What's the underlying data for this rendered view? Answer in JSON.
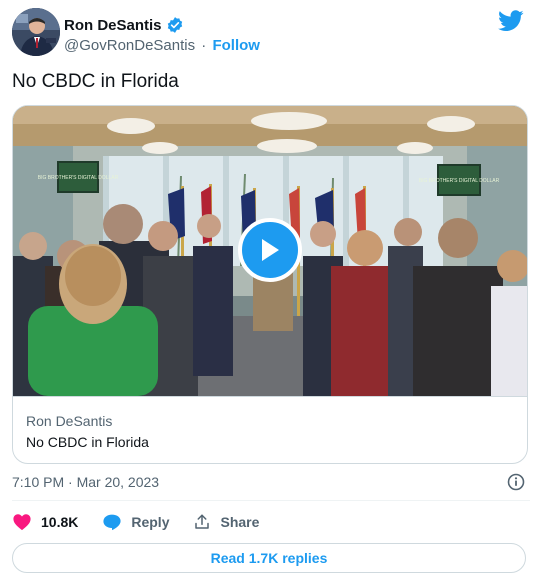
{
  "author": {
    "name": "Ron DeSantis",
    "handle": "@GovRonDeSantis",
    "separator": "·",
    "follow_label": "Follow",
    "verified_icon": "verified-badge-icon",
    "avatar_icon": "profile-photo"
  },
  "brand_icon": "twitter-bird-icon",
  "tweet": {
    "text": "No CBDC in Florida",
    "timestamp": "7:10 PM · Mar 20, 2023"
  },
  "card": {
    "media_icon": "video-thumbnail",
    "play_icon": "play-icon",
    "screen_text_1": "BIG BROTHER'S DIGITAL DOLLAR",
    "screen_text_2": "BIG BROTHER'S DIGITAL DOLLAR",
    "source": "Ron DeSantis",
    "title": "No CBDC in Florida"
  },
  "actions": {
    "likes": "10.8K",
    "reply_label": "Reply",
    "share_label": "Share"
  },
  "read_replies_label": "Read 1.7K replies",
  "colors": {
    "accent": "#1d9bf0",
    "like": "#f91880",
    "text": "#0f1419",
    "muted": "#536471",
    "border": "#cfd9de"
  }
}
